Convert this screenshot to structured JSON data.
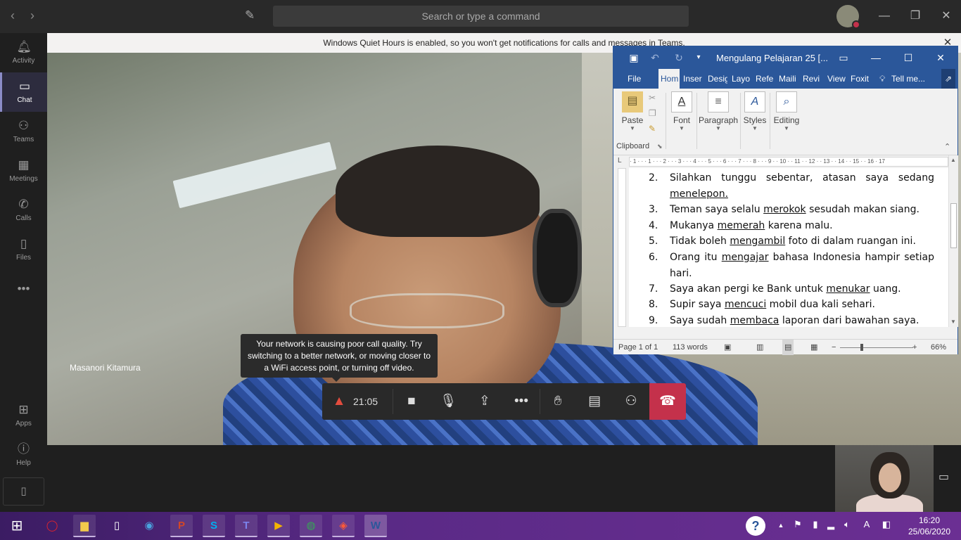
{
  "teams": {
    "search_placeholder": "Search or type a command",
    "banner_text": "Windows Quiet Hours is enabled, so you won't get notifications for calls and messages in Teams.",
    "rail": [
      {
        "label": "Activity",
        "icon": "bell-icon"
      },
      {
        "label": "Chat",
        "icon": "chat-icon"
      },
      {
        "label": "Teams",
        "icon": "teams-icon"
      },
      {
        "label": "Meetings",
        "icon": "calendar-icon"
      },
      {
        "label": "Calls",
        "icon": "phone-icon"
      },
      {
        "label": "Files",
        "icon": "file-icon"
      },
      {
        "label": "Apps",
        "icon": "apps-icon"
      },
      {
        "label": "Help",
        "icon": "help-icon"
      }
    ],
    "participant_name": "Masanori Kitamura",
    "network_tooltip": "Your network is causing poor call quality. Try switching to a better network, or moving closer to a WiFi access point, or turning off video.",
    "call_timer": "21:05"
  },
  "word": {
    "title": "Mengulang Pelajaran 25 [...",
    "tabs": [
      "File",
      "Hom",
      "Inser",
      "Desig",
      "Layo",
      "Refe",
      "Maili",
      "Revi",
      "View",
      "Foxit",
      "Tell me..."
    ],
    "ribbon": {
      "paste": "Paste",
      "font": "Font",
      "paragraph": "Paragraph",
      "styles": "Styles",
      "editing": "Editing",
      "clipboard": "Clipboard"
    },
    "ruler_text": "· 1 · · · 1 · · · 2 · · · 3 · · · 4 · · · 5 · · · 6 · · · 7 · · · 8 · · · 9 · · 10 · · 11 · · 12 · · 13 · · 14 · · 15 · · 16 · 17",
    "document_lines": [
      {
        "num": "2.",
        "pre": "Silahkan tunggu sebentar, atasan saya sedang ",
        "u": "menelepon.",
        "post": ""
      },
      {
        "num": "3.",
        "pre": "Teman saya selalu ",
        "u": "merokok",
        "post": " sesudah makan siang."
      },
      {
        "num": "4.",
        "pre": "Mukanya ",
        "u": "memerah",
        "post": " karena malu."
      },
      {
        "num": "5.",
        "pre": "Tidak boleh ",
        "u": "mengambil",
        "post": " foto di dalam ruangan ini."
      },
      {
        "num": "6.",
        "pre": "Orang itu ",
        "u": "mengajar",
        "post": " bahasa Indonesia hampir setiap hari."
      },
      {
        "num": "7.",
        "pre": "Saya akan pergi ke Bank untuk ",
        "u": "menukar",
        "post": " uang."
      },
      {
        "num": "8.",
        "pre": "Supir saya ",
        "u": "mencuci",
        "post": " mobil dua kali sehari."
      },
      {
        "num": "9.",
        "pre": "Saya sudah ",
        "u": "membaca",
        "post": " laporan dari bawahan saya."
      }
    ],
    "status": {
      "page": "Page 1 of 1",
      "words": "113 words",
      "zoom": "66%"
    }
  },
  "taskbar": {
    "apps": [
      "start-icon",
      "opera-icon",
      "file-explorer-icon",
      "notepad-icon",
      "zoom-icon",
      "powerpoint-icon",
      "skype-icon",
      "teams-icon",
      "media-player-icon",
      "chrome-icon",
      "acrobat-icon",
      "word-icon"
    ],
    "time": "16:20",
    "date": "25/06/2020"
  },
  "colors": {
    "word_blue": "#2b579a",
    "hangup_red": "#c4314b",
    "teams_purple": "#8b8cc7"
  }
}
